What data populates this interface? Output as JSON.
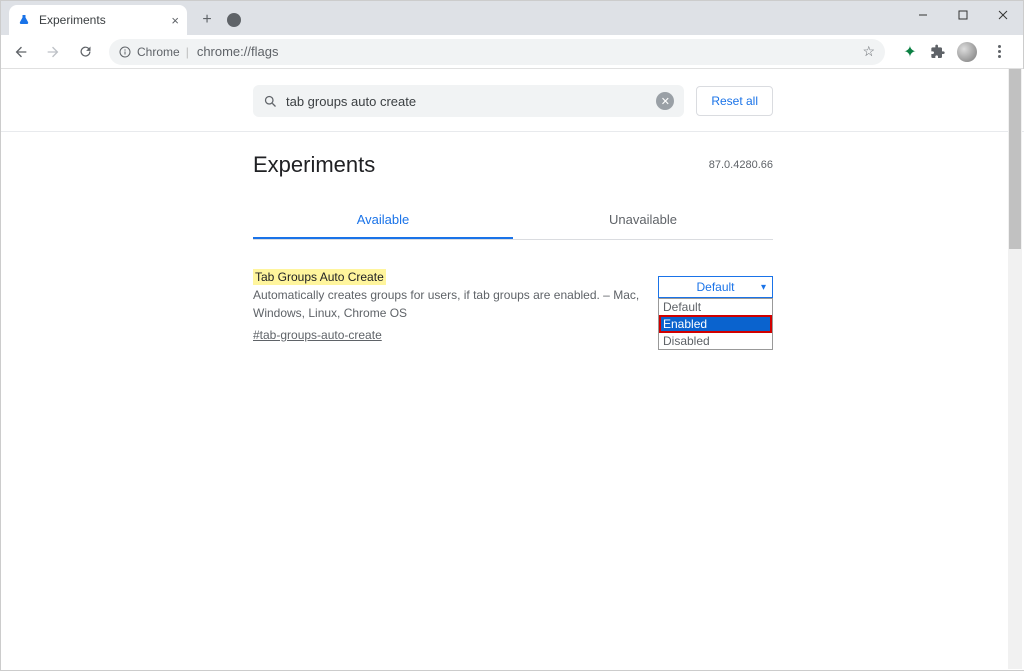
{
  "browser": {
    "tab_title": "Experiments",
    "omnibox_chip": "Chrome",
    "omnibox_url": "chrome://flags"
  },
  "search": {
    "value": "tab groups auto create",
    "reset_label": "Reset all"
  },
  "header": {
    "title": "Experiments",
    "version": "87.0.4280.66"
  },
  "tabs": {
    "available": "Available",
    "unavailable": "Unavailable"
  },
  "flag": {
    "name": "Tab Groups Auto Create",
    "description": "Automatically creates groups for users, if tab groups are enabled. – Mac, Windows, Linux, Chrome OS",
    "hash": "#tab-groups-auto-create",
    "selected": "Default",
    "options": {
      "default": "Default",
      "enabled": "Enabled",
      "disabled": "Disabled"
    }
  }
}
